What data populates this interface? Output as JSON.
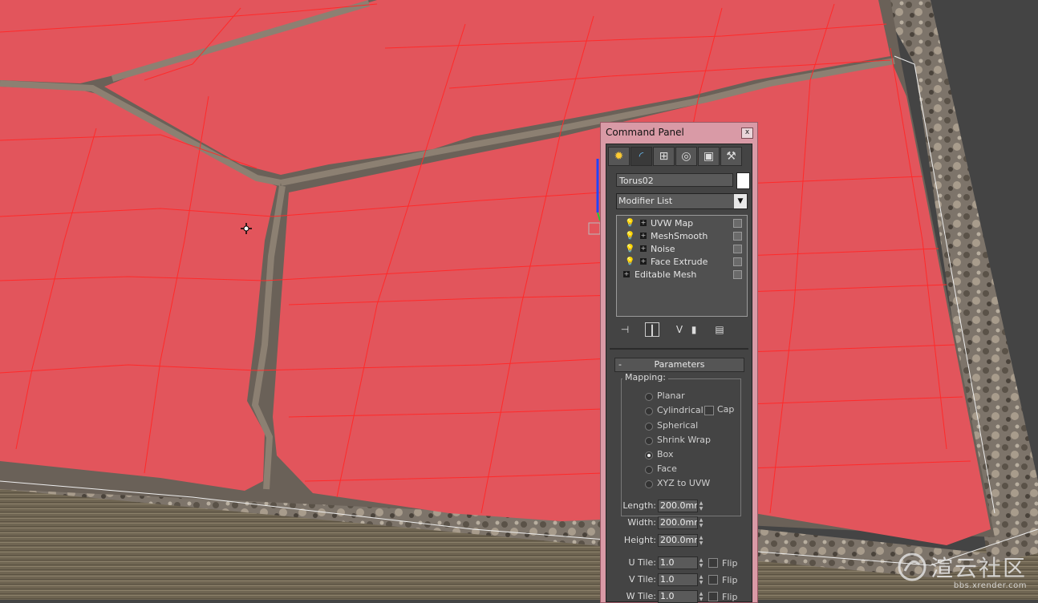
{
  "panel": {
    "title": "Command Panel",
    "close_glyph": "x",
    "tabs": [
      {
        "name": "create-tab-icon",
        "glyph": "✹"
      },
      {
        "name": "modify-tab-icon",
        "glyph": "◜"
      },
      {
        "name": "hierarchy-tab-icon",
        "glyph": "⊞"
      },
      {
        "name": "motion-tab-icon",
        "glyph": "◎"
      },
      {
        "name": "display-tab-icon",
        "glyph": "▣"
      },
      {
        "name": "utilities-tab-icon",
        "glyph": "⚒"
      }
    ],
    "object_name": "Torus02",
    "object_color": "#ffffff",
    "modifier_list_label": "Modifier List",
    "stack": [
      "UVW Map",
      "MeshSmooth",
      "Noise",
      "Face Extrude",
      "Editable Mesh"
    ]
  },
  "parameters": {
    "rollout_title": "Parameters",
    "rollout_toggle": "-",
    "mapping_label": "Mapping:",
    "mapping_options": [
      "Planar",
      "Cylindrical",
      "Spherical",
      "Shrink Wrap",
      "Box",
      "Face",
      "XYZ to UVW"
    ],
    "selected_mapping": "Box",
    "cap_label": "Cap",
    "length_label": "Length:",
    "length_value": "200.0mm",
    "width_label": "Width:",
    "width_value": "200.0mm",
    "height_label": "Height:",
    "height_value": "200.0mm",
    "utile_label": "U Tile:",
    "utile_value": "1.0",
    "vtile_label": "V Tile:",
    "vtile_value": "1.0",
    "wtile_label": "W Tile:",
    "wtile_value": "1.0",
    "flip_label": "Flip"
  },
  "watermark": {
    "text": "渲云社区",
    "url": "bbs.xrender.com"
  },
  "colors": {
    "viewport_bg": "#444444",
    "selection_red": "#e2555c",
    "wire_red": "#ff1e1e",
    "panel_title_bg": "#d99aa6"
  }
}
